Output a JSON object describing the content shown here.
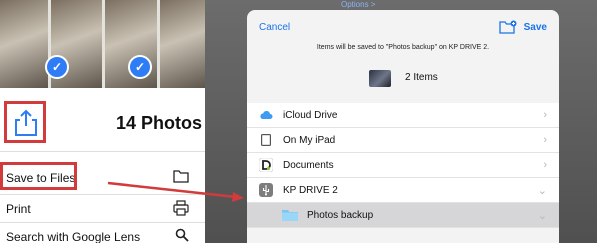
{
  "left_panel": {
    "photo_count_label": "14 Photos",
    "menu": [
      {
        "label": "Save to Files",
        "icon": "folder-icon"
      },
      {
        "label": "Print",
        "icon": "printer-icon"
      },
      {
        "label": "Search with Google Lens",
        "icon": "search-icon"
      }
    ]
  },
  "right_panel": {
    "top_link": "Options >",
    "cancel_label": "Cancel",
    "save_label": "Save",
    "info_text": "Items will be saved to \"Photos backup\" on KP DRIVE 2.",
    "items_label": "2 Items",
    "locations": [
      {
        "label": "iCloud Drive",
        "icon": "cloud-icon",
        "chevron": "›"
      },
      {
        "label": "On My iPad",
        "icon": "ipad-icon",
        "chevron": "›"
      },
      {
        "label": "Documents",
        "icon": "documents-app-icon",
        "chevron": "›"
      },
      {
        "label": "KP DRIVE 2",
        "icon": "usb-drive-icon",
        "chevron": "⌄"
      }
    ],
    "selected_folder": {
      "label": "Photos backup",
      "icon": "folder-icon",
      "chevron": "⌄"
    }
  },
  "colors": {
    "highlight": "#d23b3b",
    "accent": "#1a73e8",
    "checkmark": "#2f7df6"
  }
}
